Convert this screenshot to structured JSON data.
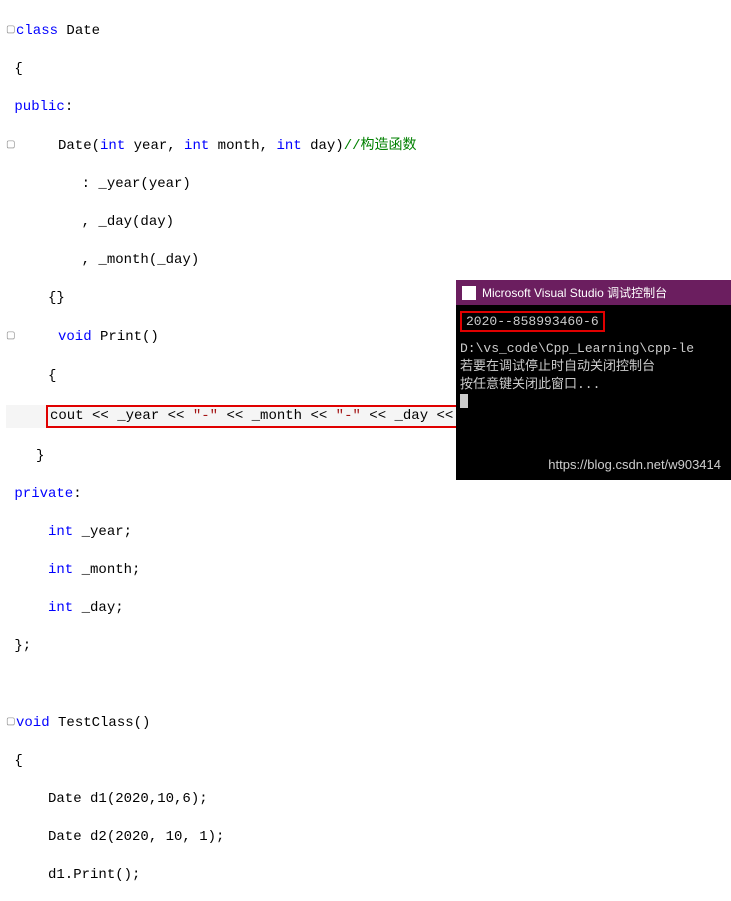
{
  "code": {
    "l1a": "class",
    "l1b": " Date",
    "l2": " {",
    "l3a": " public",
    "l3b": ":",
    "l4a": "     Date(",
    "l4b": "int",
    "l4c": " year, ",
    "l4d": "int",
    "l4e": " month, ",
    "l4f": "int",
    "l4g": " day)",
    "l4h": "//构造函数",
    "l5": "         : _year(year)",
    "l6": "         , _day(day)",
    "l7": "         , _month(_day)",
    "l8": "     {}",
    "l9a": "     void",
    "l9b": " Print()",
    "l10": "     {",
    "l11a": "cout << _year << ",
    "l11b": "\"-\"",
    "l11c": " << _month << ",
    "l11d": "\"-\"",
    "l11e": " << _day << endl;",
    "l12": "}",
    "l13a": " private",
    "l13b": ":",
    "l14a": "     int",
    "l14b": " _year;",
    "l15a": "     int",
    "l15b": " _month;",
    "l16a": "     int",
    "l16b": " _day;",
    "l17": " };",
    "l18": "",
    "l19a": "void",
    "l19b": " TestClass()",
    "l20": " {",
    "l21": "     Date d1(2020,10,6);",
    "l22": "     Date d2(2020, 10, 1);",
    "l23": "     d1.Print();"
  },
  "console": {
    "title": "Microsoft Visual Studio 调试控制台",
    "output": "2020--858993460-6",
    "path": "D:\\vs_code\\Cpp_Learning\\cpp-le",
    "msg1": "若要在调试停止时自动关闭控制台",
    "msg2": "按任意键关闭此窗口..."
  },
  "watermark": "https://blog.csdn.net/w903414"
}
